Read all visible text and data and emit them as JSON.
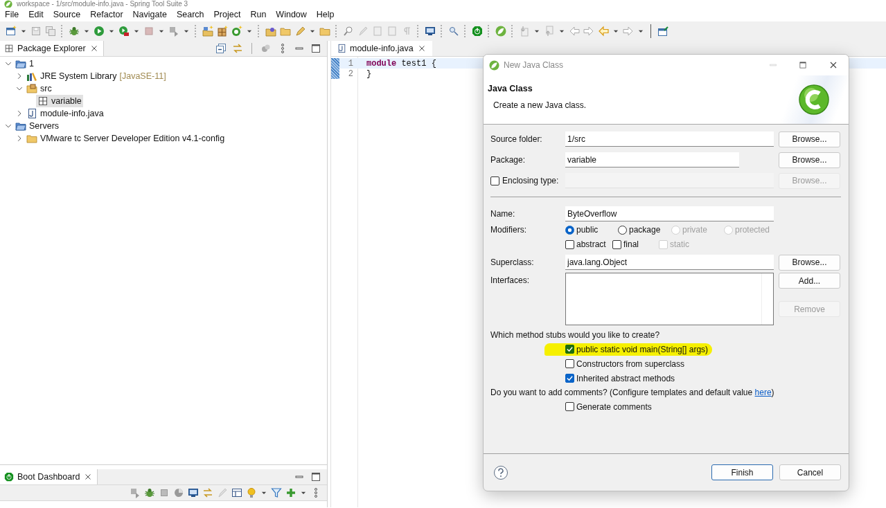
{
  "window": {
    "title": "workspace - 1/src/module-info.java - Spring Tool Suite 3"
  },
  "menu": [
    "File",
    "Edit",
    "Source",
    "Refactor",
    "Navigate",
    "Search",
    "Project",
    "Run",
    "Window",
    "Help"
  ],
  "package_explorer": {
    "title": "Package Explorer",
    "selected": true,
    "tree": [
      {
        "label": "1",
        "kind": "project",
        "expanded": true,
        "selected": false,
        "children": [
          {
            "label": "JRE System Library",
            "decoration": "[JavaSE-11]",
            "kind": "library",
            "expanded": false,
            "selected": false
          },
          {
            "label": "src",
            "kind": "source",
            "expanded": true,
            "selected": false,
            "children": [
              {
                "label": "variable",
                "kind": "package",
                "selected": true
              }
            ]
          },
          {
            "label": "module-info.java",
            "kind": "file",
            "expanded": false,
            "selected": false
          }
        ]
      },
      {
        "label": "Servers",
        "kind": "project",
        "expanded": true,
        "selected": false,
        "children": [
          {
            "label": "VMware tc Server Developer Edition v4.1-config",
            "kind": "folder",
            "expanded": false,
            "selected": false
          }
        ]
      }
    ]
  },
  "editor": {
    "tabs": [
      {
        "label": "module-info.java",
        "selected": true
      }
    ],
    "lines": [
      {
        "number": "1",
        "current": true,
        "tokens": [
          {
            "text": "module",
            "kind": "keyword"
          },
          {
            "text": " test1 {",
            "kind": "plain"
          }
        ]
      },
      {
        "number": "2",
        "current": false,
        "tokens": [
          {
            "text": "}",
            "kind": "plain"
          }
        ]
      }
    ]
  },
  "boot_dashboard": {
    "title": "Boot Dashboard"
  },
  "dialog": {
    "title": "New Java Class",
    "heading": "Java Class",
    "description": "Create a new Java class.",
    "source_folder": {
      "label": "Source folder:",
      "value": "1/src",
      "button": {
        "label": "Browse...",
        "disabled": false
      }
    },
    "package": {
      "label": "Package:",
      "value": "variable",
      "button": {
        "label": "Browse...",
        "disabled": false
      }
    },
    "enclosing_type": {
      "label": "Enclosing type:",
      "checked": false,
      "button": {
        "label": "Browse...",
        "disabled": true
      }
    },
    "name": {
      "label": "Name:",
      "value": "ByteOverflow"
    },
    "modifiers": {
      "label": "Modifiers:",
      "access": [
        {
          "label": "public",
          "selected": true,
          "disabled": false
        },
        {
          "label": "package",
          "selected": false,
          "disabled": false
        },
        {
          "label": "private",
          "selected": false,
          "disabled": true
        },
        {
          "label": "protected",
          "selected": false,
          "disabled": true
        }
      ],
      "flags": [
        {
          "label": "abstract",
          "checked": false,
          "disabled": false
        },
        {
          "label": "final",
          "checked": false,
          "disabled": false
        },
        {
          "label": "static",
          "checked": false,
          "disabled": true
        }
      ]
    },
    "superclass": {
      "label": "Superclass:",
      "value": "java.lang.Object",
      "button": {
        "label": "Browse...",
        "disabled": false
      }
    },
    "interfaces": {
      "label": "Interfaces:",
      "buttons": [
        {
          "label": "Add...",
          "disabled": false
        },
        {
          "label": "Remove",
          "disabled": true
        }
      ]
    },
    "stubs": {
      "question": "Which method stubs would you like to create?",
      "options": [
        {
          "label": "public static void main(String[] args)",
          "checked": true,
          "highlighted": true
        },
        {
          "label": "Constructors from superclass",
          "checked": false,
          "highlighted": false
        },
        {
          "label": "Inherited abstract methods",
          "checked": true,
          "highlighted": false
        }
      ]
    },
    "comments": {
      "question": "Do you want to add comments? (Configure templates and default value ",
      "link": "here",
      "after": ")",
      "options": [
        {
          "label": "Generate comments",
          "checked": false
        }
      ]
    },
    "buttons": [
      {
        "label": "Finish",
        "default": true
      },
      {
        "label": "Cancel",
        "default": false
      }
    ]
  }
}
